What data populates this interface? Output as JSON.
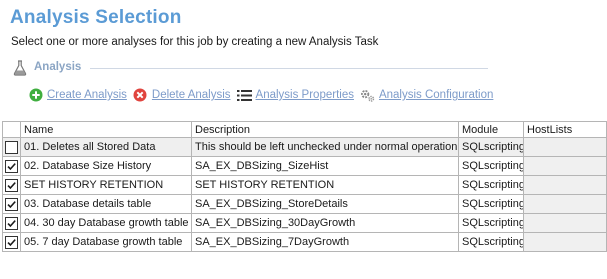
{
  "header": {
    "title": "Analysis Selection",
    "subtitle": "Select one or more analyses for this job by creating a new Analysis Task"
  },
  "section": {
    "label": "Analysis",
    "icon": "flask-icon"
  },
  "toolbar": {
    "create": {
      "label": "Create Analysis",
      "icon": "plus-circle-icon",
      "color": "#3fae3f"
    },
    "delete": {
      "label": "Delete Analysis",
      "icon": "x-circle-icon",
      "color": "#e0443e"
    },
    "properties": {
      "label": "Analysis Properties",
      "icon": "list-icon"
    },
    "configuration": {
      "label": "Analysis Configuration",
      "icon": "gears-icon"
    },
    "link_color": "#7d9bc9"
  },
  "grid": {
    "columns": [
      "Name",
      "Description",
      "Module",
      "HostLists"
    ],
    "rows": [
      {
        "checked": false,
        "name": "01. Deletes all Stored Data",
        "description": "This should be left unchecked under normal operation.",
        "module": "SQLscripting",
        "hostlists": ""
      },
      {
        "checked": true,
        "name": "02. Database Size History",
        "description": "SA_EX_DBSizing_SizeHist",
        "module": "SQLscripting",
        "hostlists": ""
      },
      {
        "checked": true,
        "name": "SET HISTORY RETENTION",
        "description": "SET HISTORY RETENTION",
        "module": "SQLscripting",
        "hostlists": ""
      },
      {
        "checked": true,
        "name": "03. Database details table",
        "description": "SA_EX_DBSizing_StoreDetails",
        "module": "SQLscripting",
        "hostlists": ""
      },
      {
        "checked": true,
        "name": "04. 30 day Database growth table",
        "description": "SA_EX_DBSizing_30DayGrowth",
        "module": "SQLscripting",
        "hostlists": ""
      },
      {
        "checked": true,
        "name": "05. 7 day Database growth table",
        "description": "SA_EX_DBSizing_7DayGrowth",
        "module": "SQLscripting",
        "hostlists": ""
      }
    ]
  },
  "colors": {
    "title": "#5b9bd5",
    "section_label": "#8ba5c4"
  }
}
